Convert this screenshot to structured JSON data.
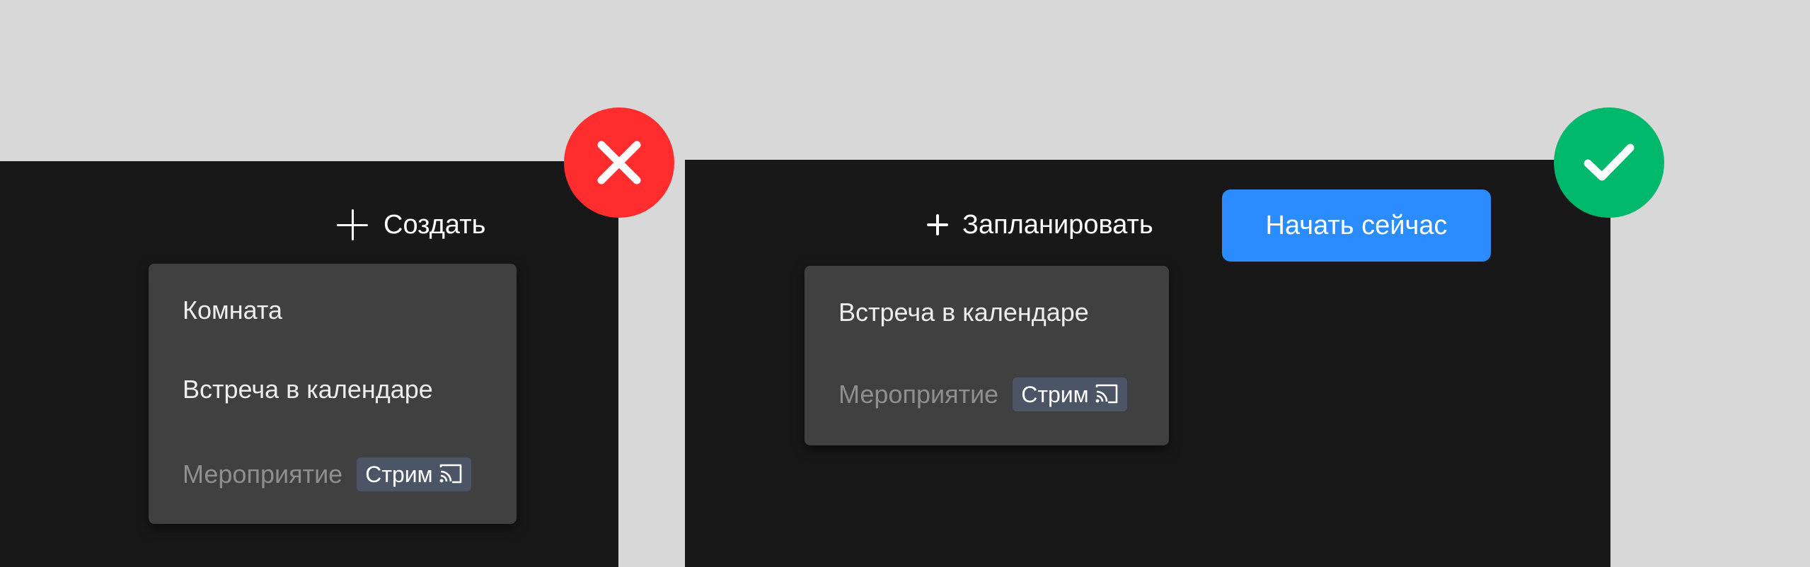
{
  "colors": {
    "background": "#d8d8d8",
    "panel": "#181818",
    "menu": "#404040",
    "primary_button": "#2a8cff",
    "stream_badge": "#4c5566",
    "bad_marker": "#ff2d2d",
    "good_marker": "#00b86b"
  },
  "bad_example": {
    "create_label": "Создать",
    "menu": {
      "items": [
        {
          "label": "Комната"
        },
        {
          "label": "Встреча в календаре"
        },
        {
          "label": "Мероприятие",
          "badge": "Стрим",
          "badge_icon": "cast-icon"
        }
      ]
    },
    "marker_icon": "close-icon"
  },
  "good_example": {
    "schedule_label": "Запланировать",
    "start_now_label": "Начать сейчас",
    "menu": {
      "items": [
        {
          "label": "Встреча в календаре"
        },
        {
          "label": "Мероприятие",
          "badge": "Стрим",
          "badge_icon": "cast-icon"
        }
      ]
    },
    "marker_icon": "check-icon"
  }
}
